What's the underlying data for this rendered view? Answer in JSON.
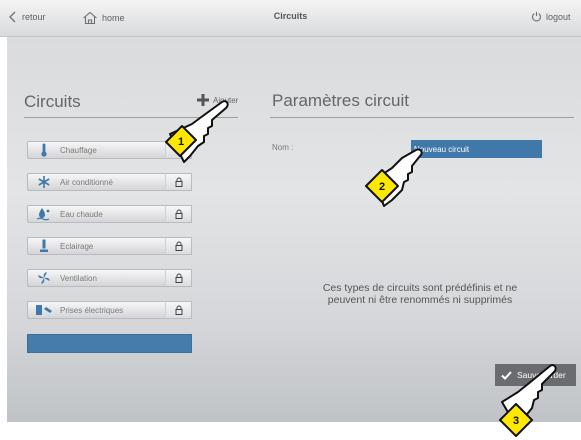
{
  "topbar": {
    "back_label": "retour",
    "home_label": "home",
    "title": "Circuits",
    "logout_label": "logout"
  },
  "left": {
    "heading": "Circuits",
    "add_label": "Ajouter",
    "circuits": [
      {
        "label": "Chauffage",
        "icon": "thermometer-icon",
        "locked": false
      },
      {
        "label": "Air conditionné",
        "icon": "snowflake-icon",
        "locked": true
      },
      {
        "label": "Eau chaude",
        "icon": "water-drop-icon",
        "locked": true
      },
      {
        "label": "Eclairage",
        "icon": "lamp-icon",
        "locked": true
      },
      {
        "label": "Ventilation",
        "icon": "fan-icon",
        "locked": true
      },
      {
        "label": "Prises électriques",
        "icon": "plug-icon",
        "locked": true
      }
    ],
    "new_circuit_label": ""
  },
  "right": {
    "heading": "Paramètres circuit",
    "name_label": "Nom :",
    "name_value": "Nouveau circuit",
    "info_line1": "Ces types de circuits sont prédéfinis et ne",
    "info_line2": "peuvent ni être renommés ni supprimés",
    "save_label": "Sauvegarder"
  },
  "annotations": {
    "step1": "1",
    "step2": "2",
    "step3": "3"
  },
  "colors": {
    "accent_blue": "#447cab",
    "save_gray": "#6a6c6f",
    "badge_yellow": "#ffe800"
  }
}
